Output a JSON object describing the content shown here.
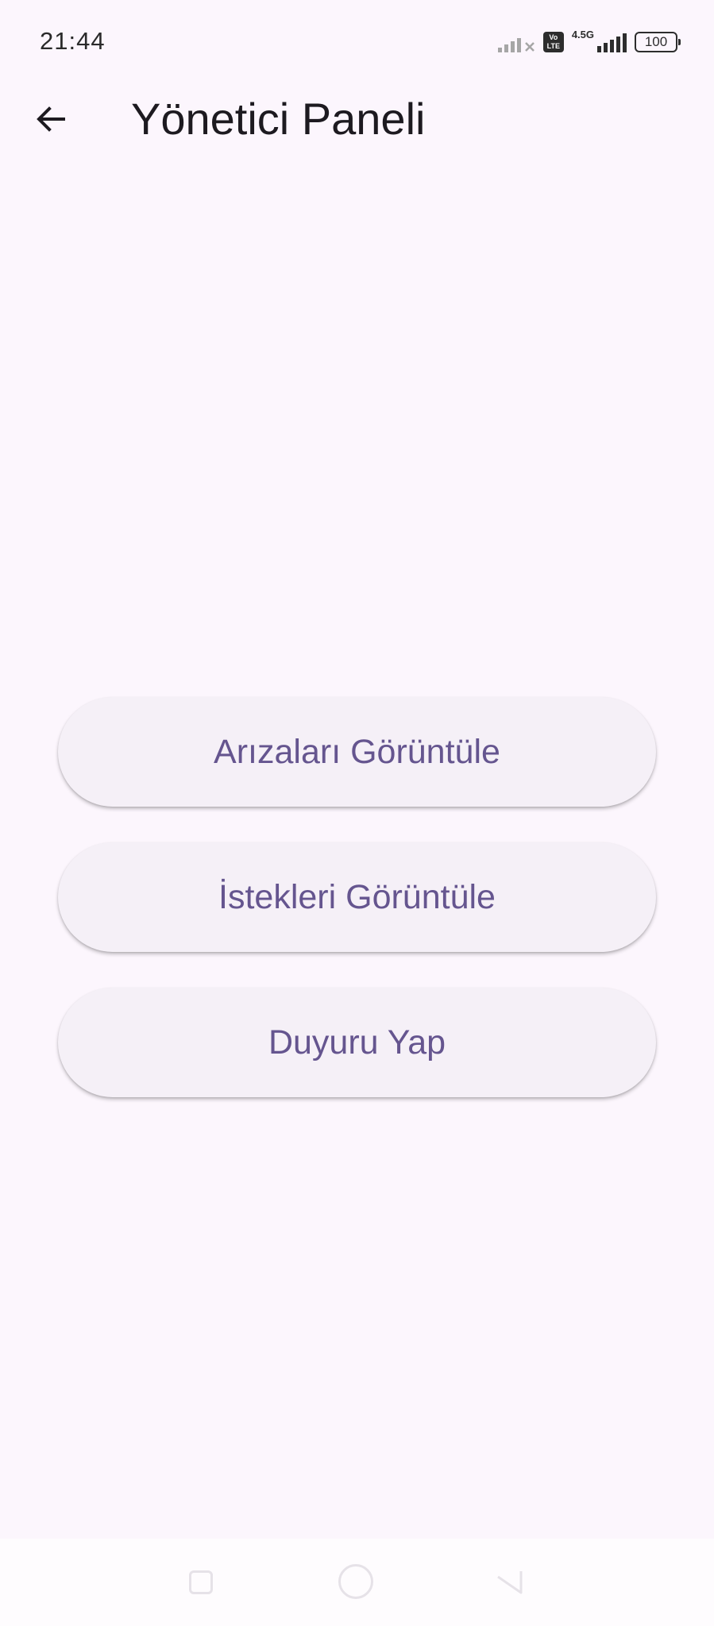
{
  "status_bar": {
    "time": "21:44",
    "network_type": "4.5G",
    "volte_top": "Vo",
    "volte_bottom": "LTE",
    "battery": "100"
  },
  "app_bar": {
    "title": "Yönetici Paneli",
    "back_icon": "arrow-left-icon"
  },
  "actions": [
    {
      "label": "Arızaları Görüntüle"
    },
    {
      "label": "İstekleri Görüntüle"
    },
    {
      "label": "Duyuru Yap"
    }
  ],
  "nav_bar": {
    "icons": [
      "recent-apps-icon",
      "home-icon",
      "back-triangle-icon"
    ]
  },
  "colors": {
    "background": "#fcf6fd",
    "button_background": "#f5f0f7",
    "button_text": "#65558f",
    "title_text": "#1d1a20"
  }
}
